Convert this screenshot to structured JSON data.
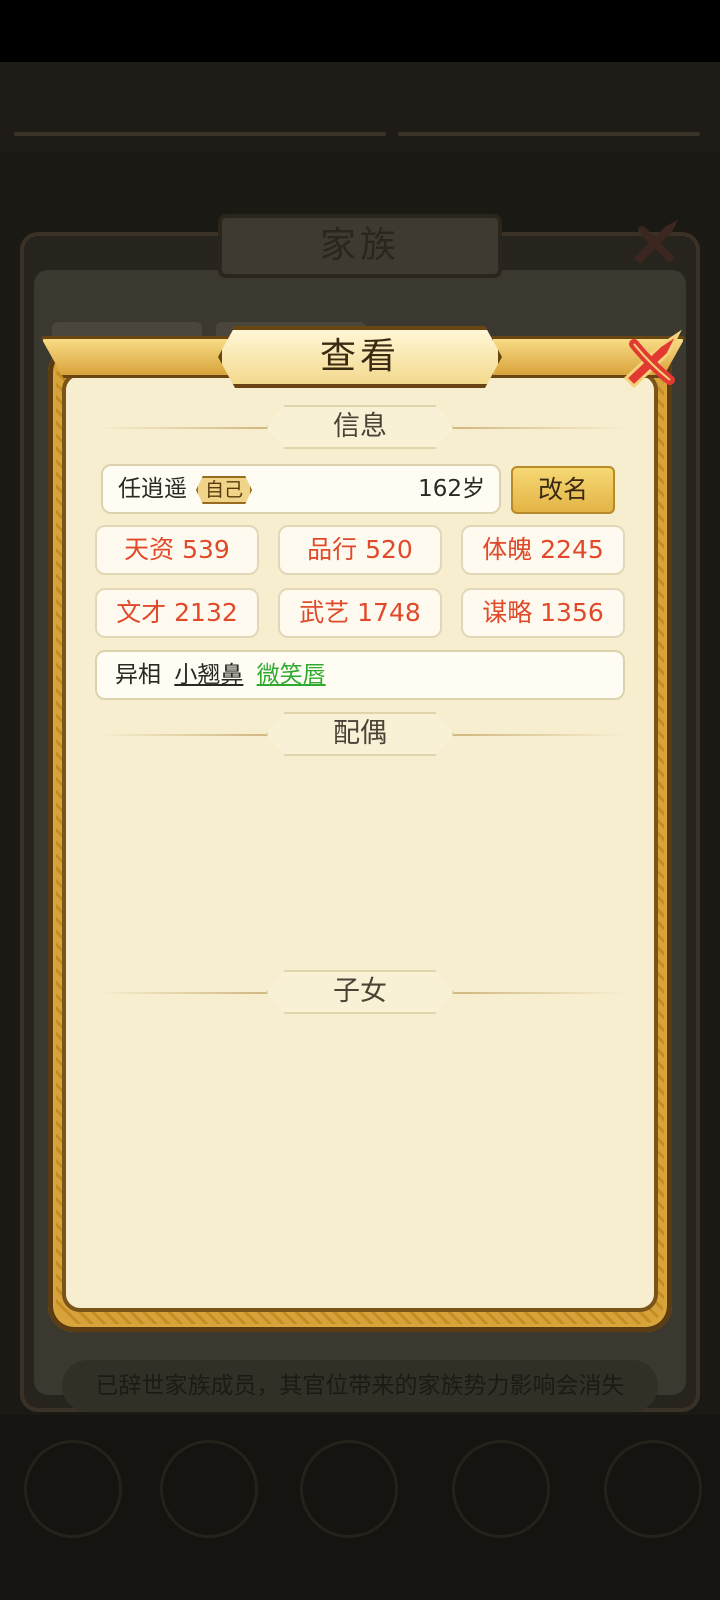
{
  "background": {
    "family_title": "家族",
    "family_note": "已辞世家族成员，其官位带来的家族势力影响会消失"
  },
  "dialog": {
    "title": "查看",
    "sections": {
      "info": "信息",
      "spouse": "配偶",
      "children": "子女"
    },
    "member": {
      "name": "任逍遥",
      "self_tag": "自己",
      "age": "162岁"
    },
    "rename_label": "改名",
    "stats": [
      {
        "label": "天资 539"
      },
      {
        "label": "品行 520"
      },
      {
        "label": "体魄 2245"
      },
      {
        "label": "文才 2132"
      },
      {
        "label": "武艺 1748"
      },
      {
        "label": "谋略 1356"
      }
    ],
    "features": {
      "label": "异相",
      "items": [
        "小翘鼻",
        "微笑唇"
      ],
      "colors": [
        "#2b2822",
        "#2faa2f"
      ]
    },
    "stat_color": "#e04a2a"
  }
}
